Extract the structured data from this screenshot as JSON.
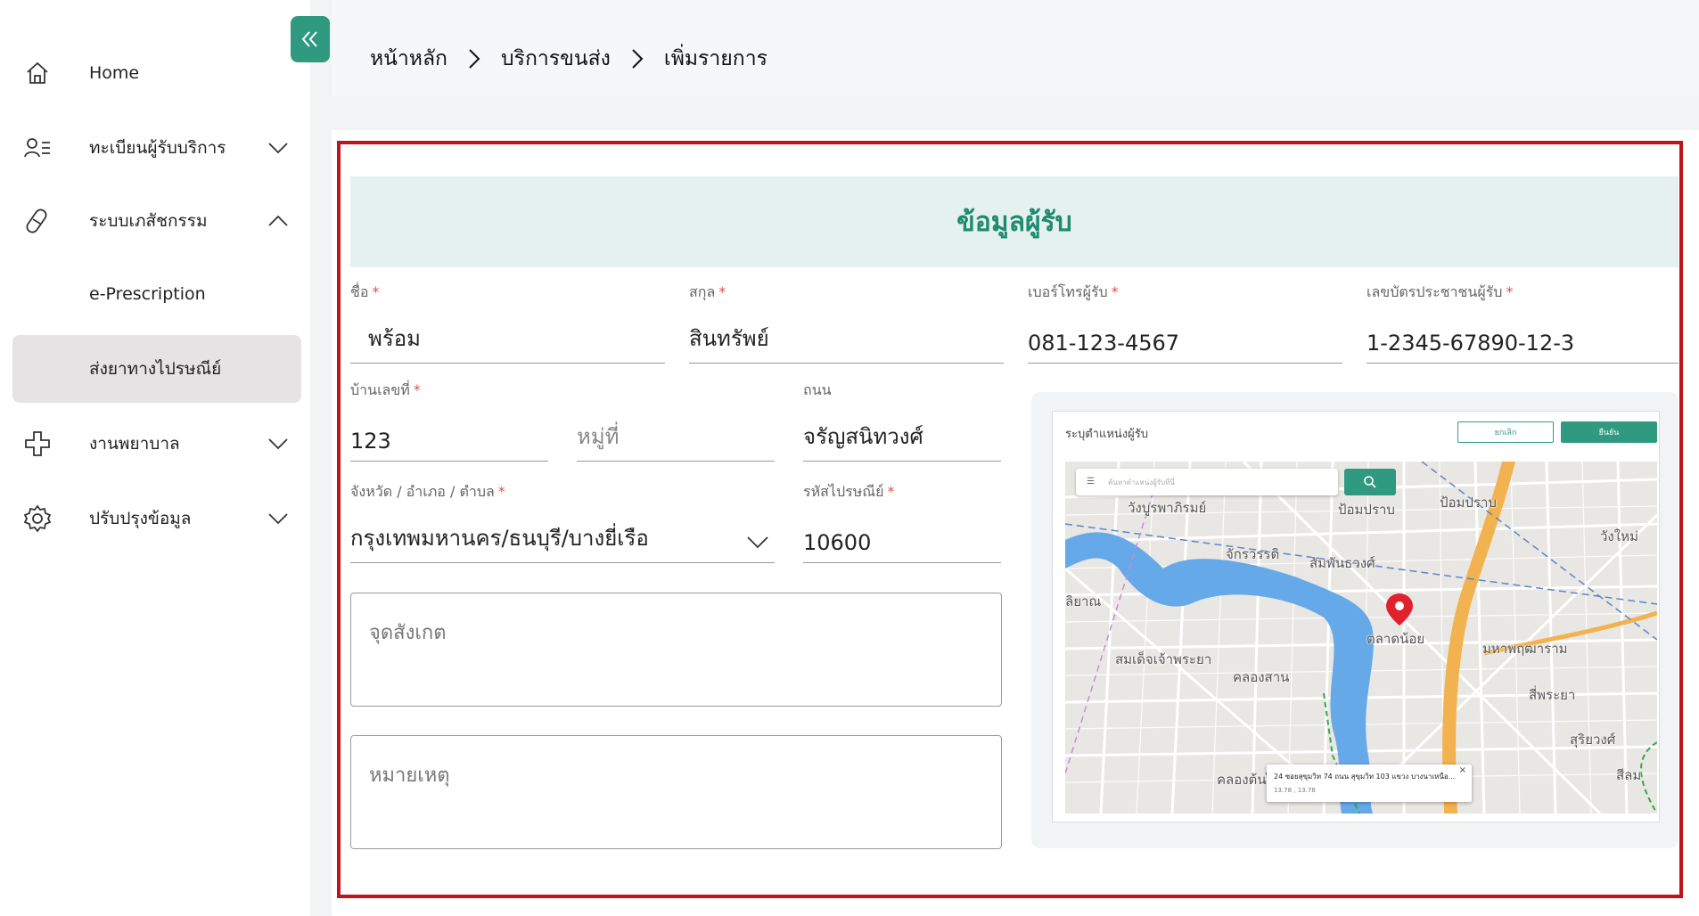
{
  "sidebar": {
    "collapse_icon": "double-chevron-left-icon",
    "items": [
      {
        "label": "Home",
        "icon": "home-icon",
        "chevron": ""
      },
      {
        "label": "ทะเบียนผู้รับบริการ",
        "icon": "user-list-icon",
        "chevron": "down"
      },
      {
        "label": "ระบบเภสัชกรรม",
        "icon": "pill-icon",
        "chevron": "up"
      },
      {
        "label": "e-Prescription",
        "icon": "",
        "chevron": ""
      },
      {
        "label": "ส่งยาทางไปรษณีย์",
        "icon": "",
        "chevron": "",
        "active": true
      },
      {
        "label": "งานพยาบาล",
        "icon": "medical-cross-icon",
        "chevron": "down"
      },
      {
        "label": "ปรับปรุงข้อมูล",
        "icon": "gear-icon",
        "chevron": "down"
      }
    ]
  },
  "breadcrumb": [
    "หน้าหลัก",
    "บริการขนส่ง",
    "เพิ่มรายการ"
  ],
  "section_title": "ข้อมูลผู้รับ",
  "form": {
    "first_name": {
      "label": "ชื่อ",
      "value": "พร้อม"
    },
    "last_name": {
      "label": "สกุล",
      "value": "สินทรัพย์"
    },
    "phone": {
      "label": "เบอร์โทรผู้รับ",
      "value": "081-123-4567"
    },
    "id_card": {
      "label": "เลขบัตรประชาชนผู้รับ",
      "value": "1-2345-67890-12-3"
    },
    "house_no": {
      "label": "บ้านเลขที่",
      "value": "123"
    },
    "moo": {
      "placeholder": "หมู่ที่"
    },
    "road": {
      "label": "ถนน",
      "value": "จรัญสนิทวงศ์"
    },
    "province": {
      "label": "จังหวัด / อำเภอ / ตำบล",
      "value": "กรุงเทพมหานคร/ธนบุรี/บางยี่เรือ"
    },
    "postcode": {
      "label": "รหัสไปรษณีย์",
      "value": "10600"
    },
    "landmark": {
      "placeholder": "จุดสังเกต"
    },
    "note": {
      "placeholder": "หมายเหตุ"
    },
    "required_mark": "*"
  },
  "map": {
    "title": "ระบุตำแหน่งผู้รับ",
    "cancel_label": "ยกเลิก",
    "confirm_label": "ยืนยัน",
    "search_placeholder": "ค้นหาตำแหน่งผู้รับที่นี่",
    "labels": [
      "วังบูรพาภิรมย์",
      "ป้อมปราบ",
      "ป้อมปราบ",
      "วังใหม่",
      "จักรวรรดิ",
      "สัมพันธวงศ์",
      "ตลาดน้อย",
      "มหาพฤฒาราม",
      "สมเด็จเจ้าพระยา",
      "คลองสาน",
      "สี่พระยา",
      "สุริยวงศ์",
      "สีลม",
      "คลองต้นไทร",
      "ลิยาณ"
    ],
    "popup_address": "24 ซอยสุขุมวิท 74 ถนน สุขุมวิท 103 แขวง บางนาเหนือ...",
    "popup_coords": "13.78 , 13.78",
    "popup_close": "×",
    "colors": {
      "river": "#66a9e8",
      "highway": "#f2b24f",
      "pin": "#e0212e"
    }
  },
  "colors": {
    "accent": "#2f9a80",
    "highlight_border": "#c0141c",
    "required": "#e05050"
  }
}
